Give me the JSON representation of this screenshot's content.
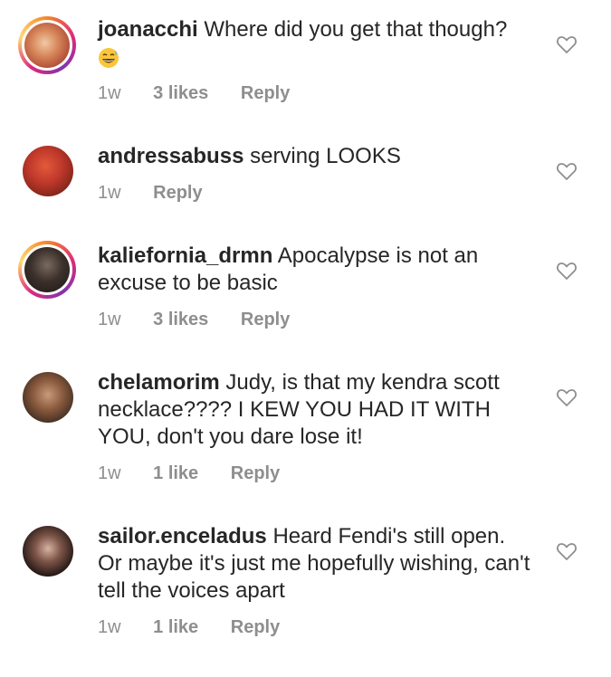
{
  "comments": [
    {
      "username": "joanacchi",
      "text": "Where did you get that though?",
      "emoji": "grinning-sweat-face-emoji",
      "time": "1w",
      "likes": "3 likes",
      "reply": "Reply",
      "ring": true
    },
    {
      "username": "andressabuss",
      "text": "serving LOOKS",
      "time": "1w",
      "reply": "Reply",
      "ring": false
    },
    {
      "username": "kaliefornia_drmn",
      "text": "Apocalypse is not an excuse to be basic",
      "time": "1w",
      "likes": "3 likes",
      "reply": "Reply",
      "ring": true
    },
    {
      "username": "chelamorim",
      "text": "Judy, is that my kendra scott necklace???? I KEW YOU HAD IT WITH YOU, don't you dare lose it!",
      "time": "1w",
      "likes": "1 like",
      "reply": "Reply",
      "ring": false
    },
    {
      "username": "sailor.enceladus",
      "text": "Heard Fendi's still open. Or maybe it's just me hopefully wishing, can't tell the voices apart",
      "time": "1w",
      "likes": "1 like",
      "reply": "Reply",
      "ring": false
    }
  ],
  "colors": {
    "text": "#262626",
    "meta": "#8e8e8e",
    "heart": "#8e8e8e"
  }
}
